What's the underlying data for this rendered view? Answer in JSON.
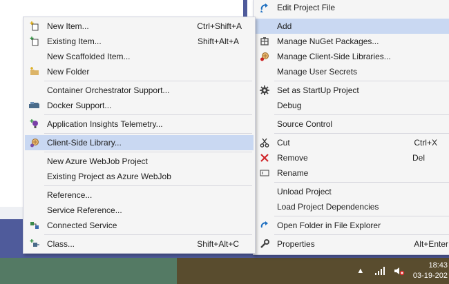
{
  "submenu": {
    "items": [
      {
        "label": "New Item...",
        "shortcut": "Ctrl+Shift+A",
        "icon": "new-item-icon"
      },
      {
        "label": "Existing Item...",
        "shortcut": "Shift+Alt+A",
        "icon": "existing-item-icon"
      },
      {
        "label": "New Scaffolded Item...",
        "shortcut": "",
        "icon": ""
      },
      {
        "label": "New Folder",
        "shortcut": "",
        "icon": "folder-icon"
      },
      {
        "label": "Container Orchestrator Support...",
        "shortcut": "",
        "icon": ""
      },
      {
        "label": "Docker Support...",
        "shortcut": "",
        "icon": "docker-icon"
      },
      {
        "label": "Application Insights Telemetry...",
        "shortcut": "",
        "icon": "insights-icon"
      },
      {
        "label": "Client-Side Library...",
        "shortcut": "",
        "icon": "library-icon"
      },
      {
        "label": "New Azure WebJob Project",
        "shortcut": "",
        "icon": ""
      },
      {
        "label": "Existing Project as Azure WebJob",
        "shortcut": "",
        "icon": ""
      },
      {
        "label": "Reference...",
        "shortcut": "",
        "icon": ""
      },
      {
        "label": "Service Reference...",
        "shortcut": "",
        "icon": ""
      },
      {
        "label": "Connected Service",
        "shortcut": "",
        "icon": "connected-service-icon"
      },
      {
        "label": "Class...",
        "shortcut": "Shift+Alt+C",
        "icon": "class-icon"
      }
    ]
  },
  "context": {
    "items": [
      {
        "label": "Edit Project File",
        "shortcut": "",
        "icon": "edit-project-icon"
      },
      {
        "label": "Add",
        "shortcut": "",
        "icon": ""
      },
      {
        "label": "Manage NuGet Packages...",
        "shortcut": "",
        "icon": "nuget-icon"
      },
      {
        "label": "Manage Client-Side Libraries...",
        "shortcut": "",
        "icon": "library-icon"
      },
      {
        "label": "Manage User Secrets",
        "shortcut": "",
        "icon": ""
      },
      {
        "label": "Set as StartUp Project",
        "shortcut": "",
        "icon": "gear-icon"
      },
      {
        "label": "Debug",
        "shortcut": "",
        "icon": ""
      },
      {
        "label": "Source Control",
        "shortcut": "",
        "icon": ""
      },
      {
        "label": "Cut",
        "shortcut": "Ctrl+X",
        "icon": "scissors-icon"
      },
      {
        "label": "Remove",
        "shortcut": "Del",
        "icon": "remove-icon"
      },
      {
        "label": "Rename",
        "shortcut": "",
        "icon": "rename-icon"
      },
      {
        "label": "Unload Project",
        "shortcut": "",
        "icon": ""
      },
      {
        "label": "Load Project Dependencies",
        "shortcut": "",
        "icon": ""
      },
      {
        "label": "Open Folder in File Explorer",
        "shortcut": "",
        "icon": "open-folder-icon"
      },
      {
        "label": "Properties",
        "shortcut": "Alt+Enter",
        "icon": "wrench-icon"
      }
    ]
  },
  "taskbar": {
    "time": "18:43",
    "date": "03-19-202",
    "tray_icons": [
      "chevron-up-icon",
      "network-icon",
      "volume-muted-icon"
    ]
  },
  "colors": {
    "menu_bg": "#f5f5f5",
    "highlight": "#c9d8f2",
    "vs_blue": "#4f5b9b",
    "taskbar_green": "#547a64",
    "taskbar_brown": "#594c2e"
  }
}
